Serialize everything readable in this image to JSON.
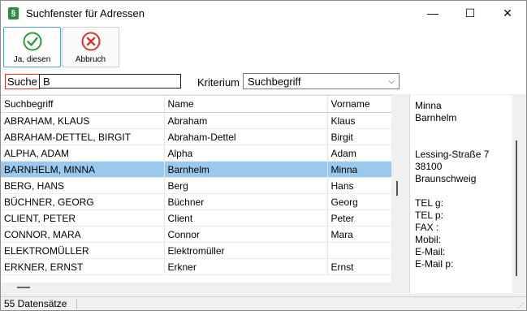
{
  "window": {
    "title": "Suchfenster für Adressen",
    "icon": "app-icon",
    "icon_glyph": "§",
    "min_glyph": "—",
    "max_glyph": "☐",
    "close_glyph": "✕"
  },
  "toolbar": {
    "yes_label": "Ja, diesen",
    "cancel_label": "Abbruch",
    "yes_color": "#2e9b3e",
    "cancel_color": "#e0302a"
  },
  "search": {
    "label": "Suche",
    "value": "B",
    "criterion_label": "Kriterium",
    "criterion_value": "Suchbegriff",
    "criterion_arrow": "⌵"
  },
  "table": {
    "columns": [
      "Suchbegriff",
      "Name",
      "Vorname"
    ],
    "rows": [
      [
        "ABRAHAM, KLAUS",
        "Abraham",
        "Klaus"
      ],
      [
        "ABRAHAM-DETTEL, BIRGIT",
        "Abraham-Dettel",
        "Birgit"
      ],
      [
        "ALPHA, ADAM",
        "Alpha",
        "Adam"
      ],
      [
        "BARNHELM, MINNA",
        "Barnhelm",
        "Minna"
      ],
      [
        "BERG, HANS",
        "Berg",
        "Hans"
      ],
      [
        "BÜCHNER, GEORG",
        "Büchner",
        "Georg"
      ],
      [
        "CLIENT, PETER",
        "Client",
        "Peter"
      ],
      [
        "CONNOR, MARA",
        "Connor",
        "Mara"
      ],
      [
        "ELEKTROMÜLLER",
        "Elektromüller",
        ""
      ],
      [
        "ERKNER, ERNST",
        "Erkner",
        "Ernst"
      ]
    ],
    "selected_index": 3,
    "selected_color": "#99c9ef"
  },
  "detail": {
    "lines": [
      "Minna",
      "Barnhelm",
      "",
      "",
      "Lessing-Straße 7",
      "38100",
      "Braunschweig",
      "",
      "TEL g:",
      "TEL p:",
      "FAX  :",
      "Mobil:",
      "E-Mail:",
      "E-Mail p:"
    ]
  },
  "status": {
    "records": "55 Datensätze",
    "grip_glyph": "⋰"
  }
}
